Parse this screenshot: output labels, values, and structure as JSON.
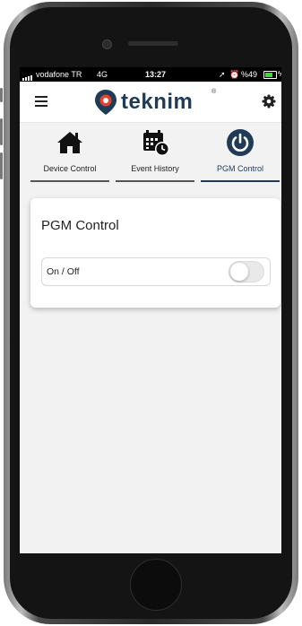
{
  "status": {
    "carrier": "vodafone TR",
    "network": "4G",
    "time": "13:27",
    "battery": "%49"
  },
  "app": {
    "brand": "teknim",
    "brand_mark": "®"
  },
  "tabs": [
    {
      "label": "Device Control",
      "icon": "home-icon",
      "active": false
    },
    {
      "label": "Event History",
      "icon": "calendar-clock-icon",
      "active": false
    },
    {
      "label": "PGM Control",
      "icon": "power-icon",
      "active": true
    }
  ],
  "card": {
    "title": "PGM Control",
    "switch_label": "On / Off",
    "switch_on": false
  },
  "colors": {
    "brand": "#1f3b57",
    "logo_red": "#e8412c",
    "active_tab": "#1f3b57"
  }
}
